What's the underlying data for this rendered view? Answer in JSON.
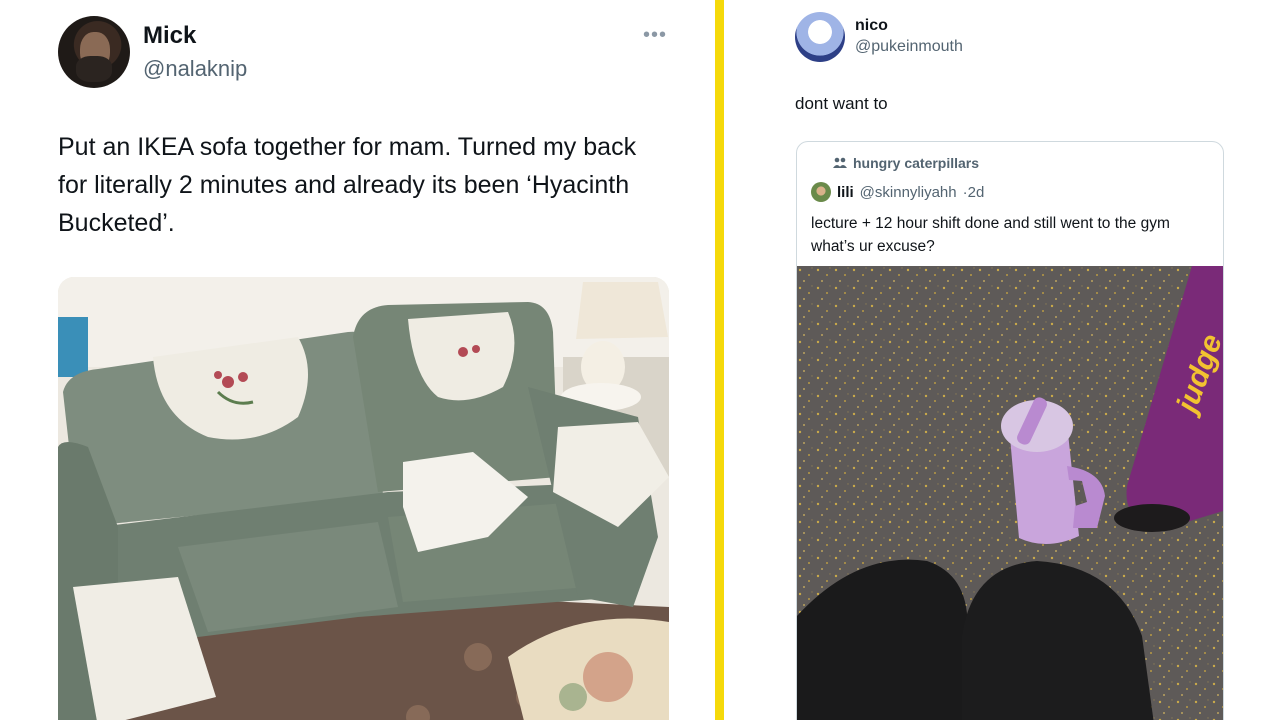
{
  "left_tweet": {
    "author_name": "Mick",
    "author_handle": "@nalaknip",
    "more_icon": "more-dots-icon",
    "text": "Put an IKEA sofa together for mam. Turned my back for literally 2 minutes and already its been ‘Hyacinth Bucketed’.",
    "media_description_icon": "photo"
  },
  "right_tweet": {
    "author_name": "nico",
    "author_handle": "@pukeinmouth",
    "text": "dont want to",
    "quoted": {
      "community_icon": "community-icon",
      "community": "hungry caterpillars",
      "author_name": "lili",
      "author_handle": "@skinnyliyahh",
      "time": "2d",
      "text": "lecture + 12 hour shift done and still went to the gym what’s ur excuse?"
    }
  },
  "colors": {
    "divider": "#f5d90a",
    "handle_gray": "#536471",
    "sofa_green": "#7b8a7c",
    "bottle_lilac": "#c9a5dc",
    "gym_bar_purple": "#7a2a78",
    "bar_text_yellow": "#f2c230"
  },
  "photo_text": {
    "bar_brand": "judge"
  }
}
